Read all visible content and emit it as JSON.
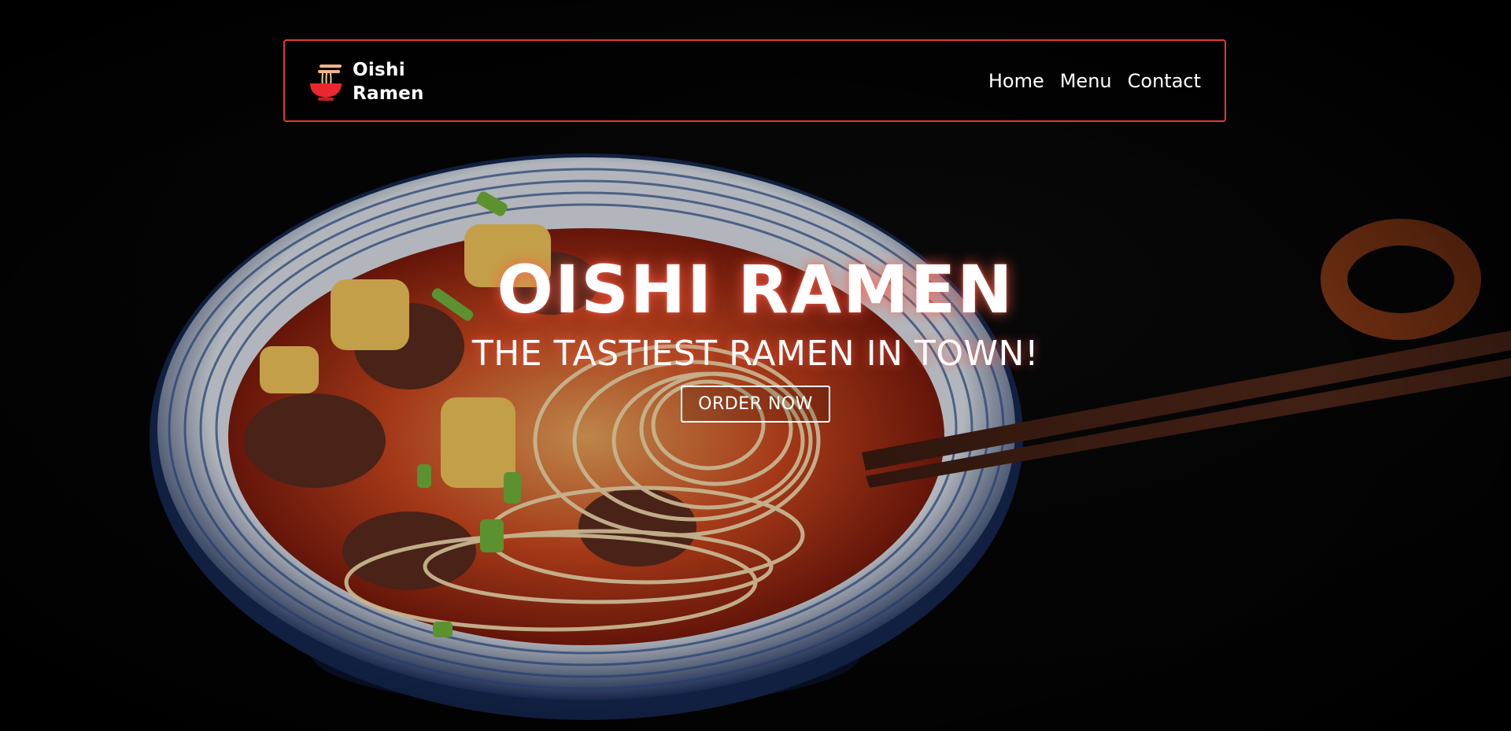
{
  "brand": {
    "line1": "Oishi",
    "line2": "Ramen",
    "logo_icon": "ramen-bowl-icon",
    "accent_color": "#e23a2e"
  },
  "nav": {
    "items": [
      {
        "label": "Home"
      },
      {
        "label": "Menu"
      },
      {
        "label": "Contact"
      }
    ]
  },
  "hero": {
    "title": "OISHI RAMEN",
    "subtitle": "THE TASTIEST RAMEN IN TOWN!",
    "cta_label": "ORDER NOW",
    "background_image": "ramen-bowl-with-chopsticks-photo"
  }
}
